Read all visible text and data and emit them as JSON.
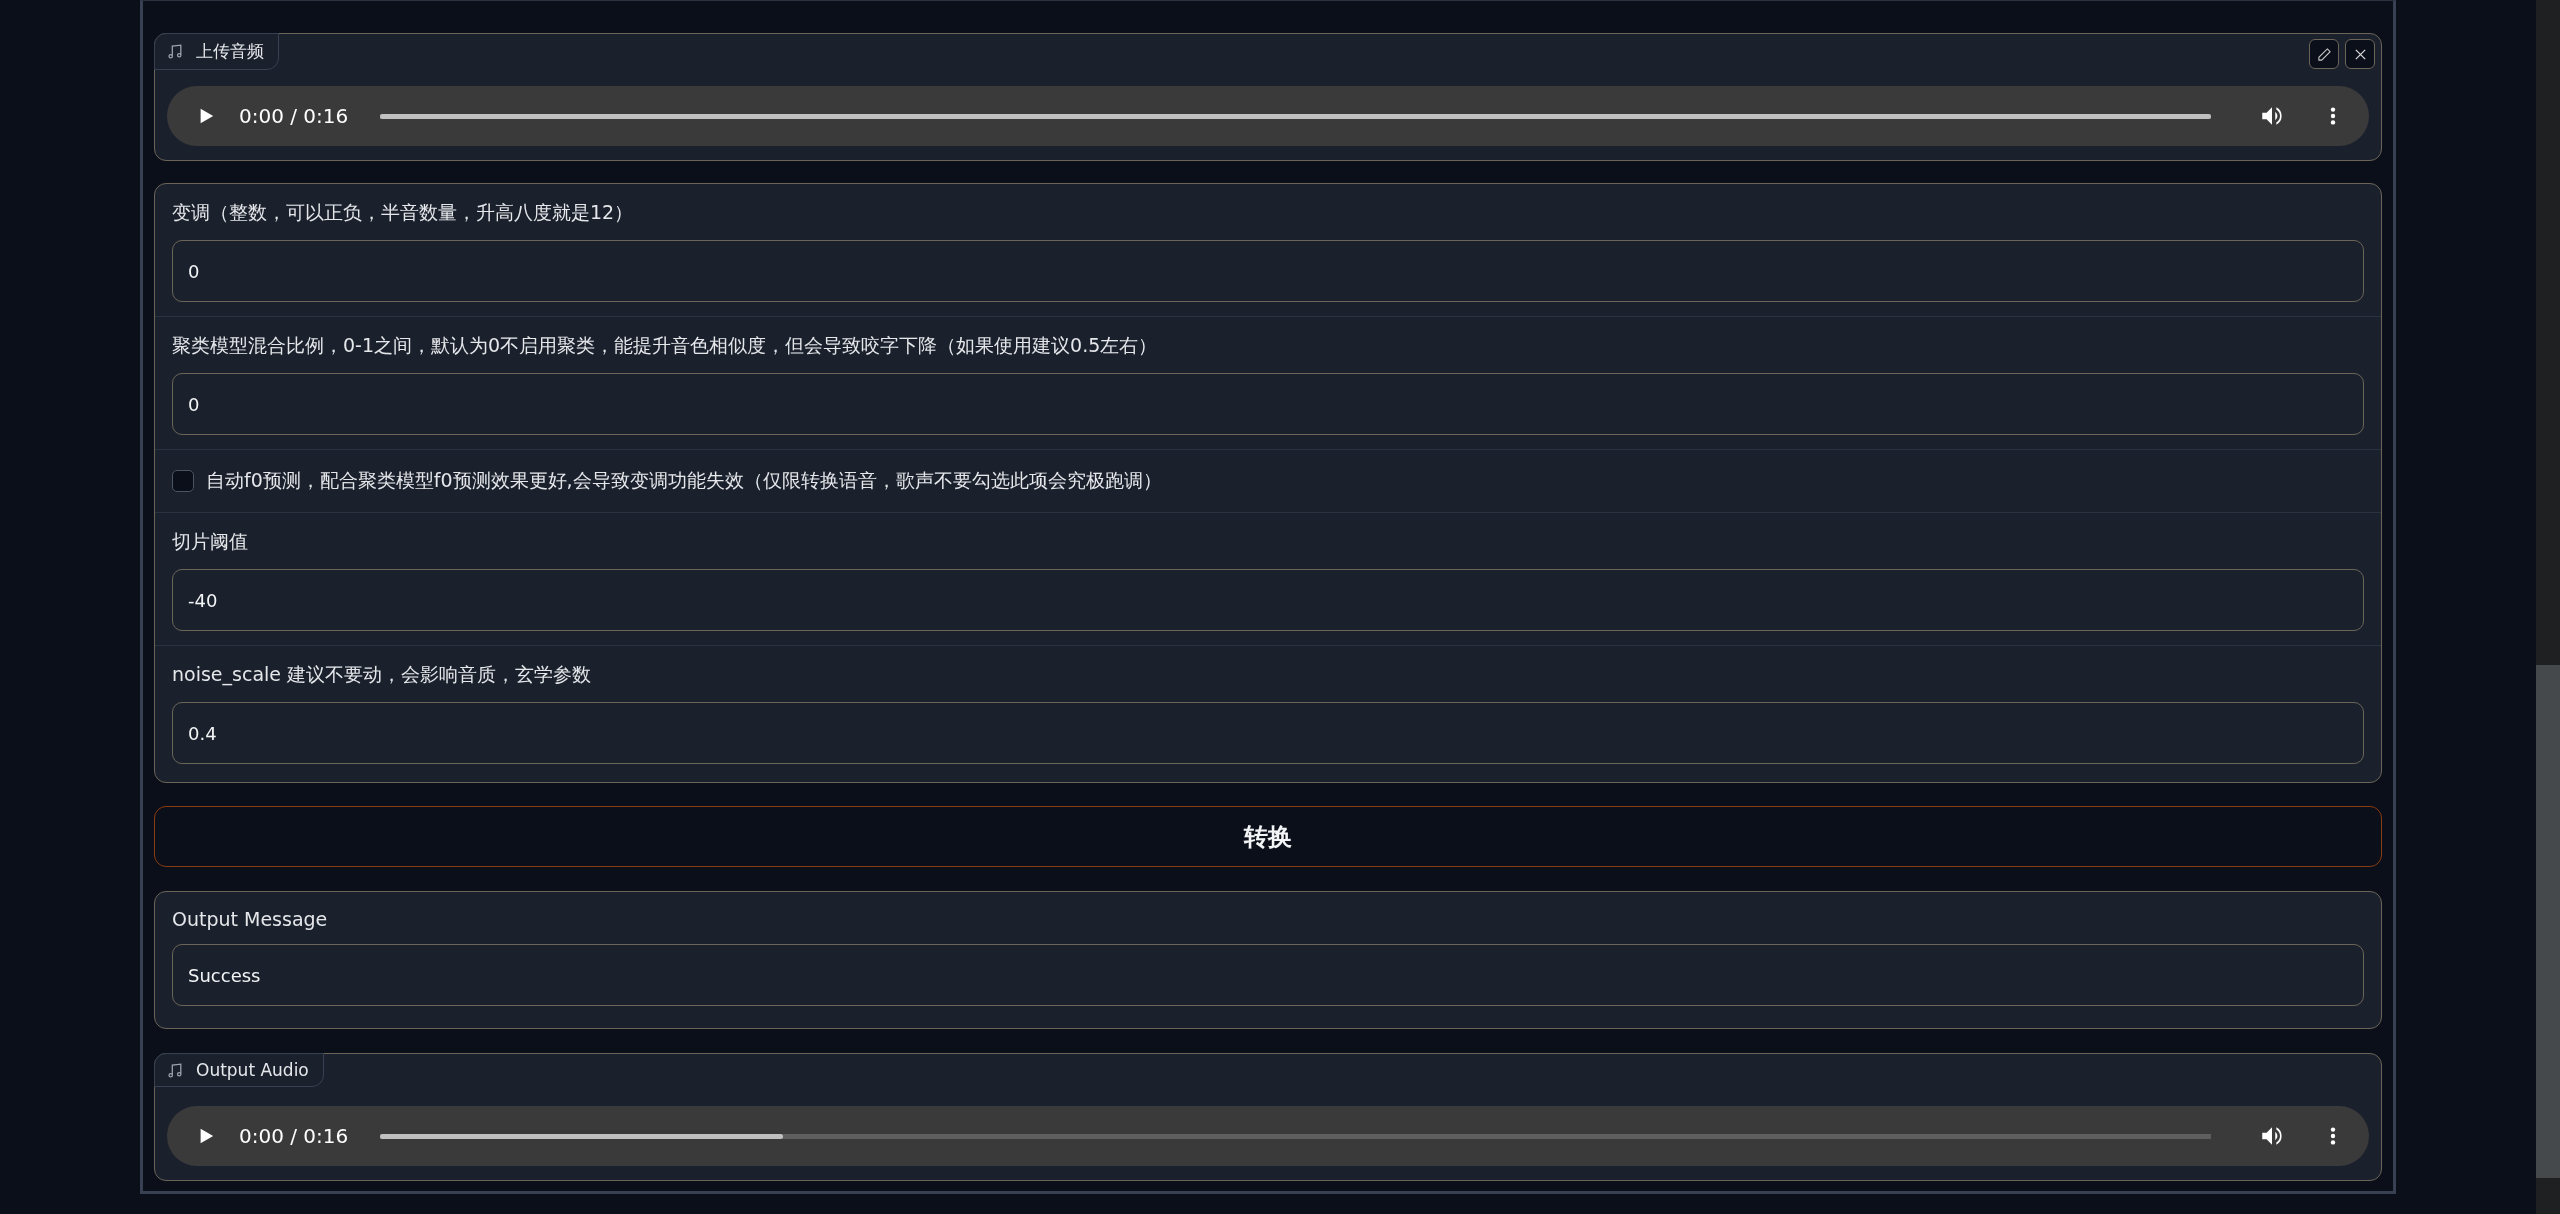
{
  "upload_audio": {
    "label": "上传音频",
    "time": "0:00 / 0:16",
    "level": 1.0
  },
  "params": [
    {
      "kind": "number",
      "label": "变调（整数，可以正负，半音数量，升高八度就是12）",
      "value": "0"
    },
    {
      "kind": "number",
      "label": "聚类模型混合比例，0-1之间，默认为0不启用聚类，能提升音色相似度，但会导致咬字下降（如果使用建议0.5左右）",
      "value": "0"
    },
    {
      "kind": "checkbox",
      "label": "自动f0预测，配合聚类模型f0预测效果更好,会导致变调功能失效（仅限转换语音，歌声不要勾选此项会究极跑调）",
      "checked": false
    },
    {
      "kind": "number",
      "label": "切片阈值",
      "value": "-40"
    },
    {
      "kind": "number",
      "label": "noise_scale 建议不要动，会影响音质，玄学参数",
      "value": "0.4"
    }
  ],
  "convert_button": "转换",
  "output_message": {
    "label": "Output Message",
    "value": "Success"
  },
  "output_audio": {
    "label": "Output Audio",
    "time": "0:00 / 0:16",
    "level": 0.22
  }
}
